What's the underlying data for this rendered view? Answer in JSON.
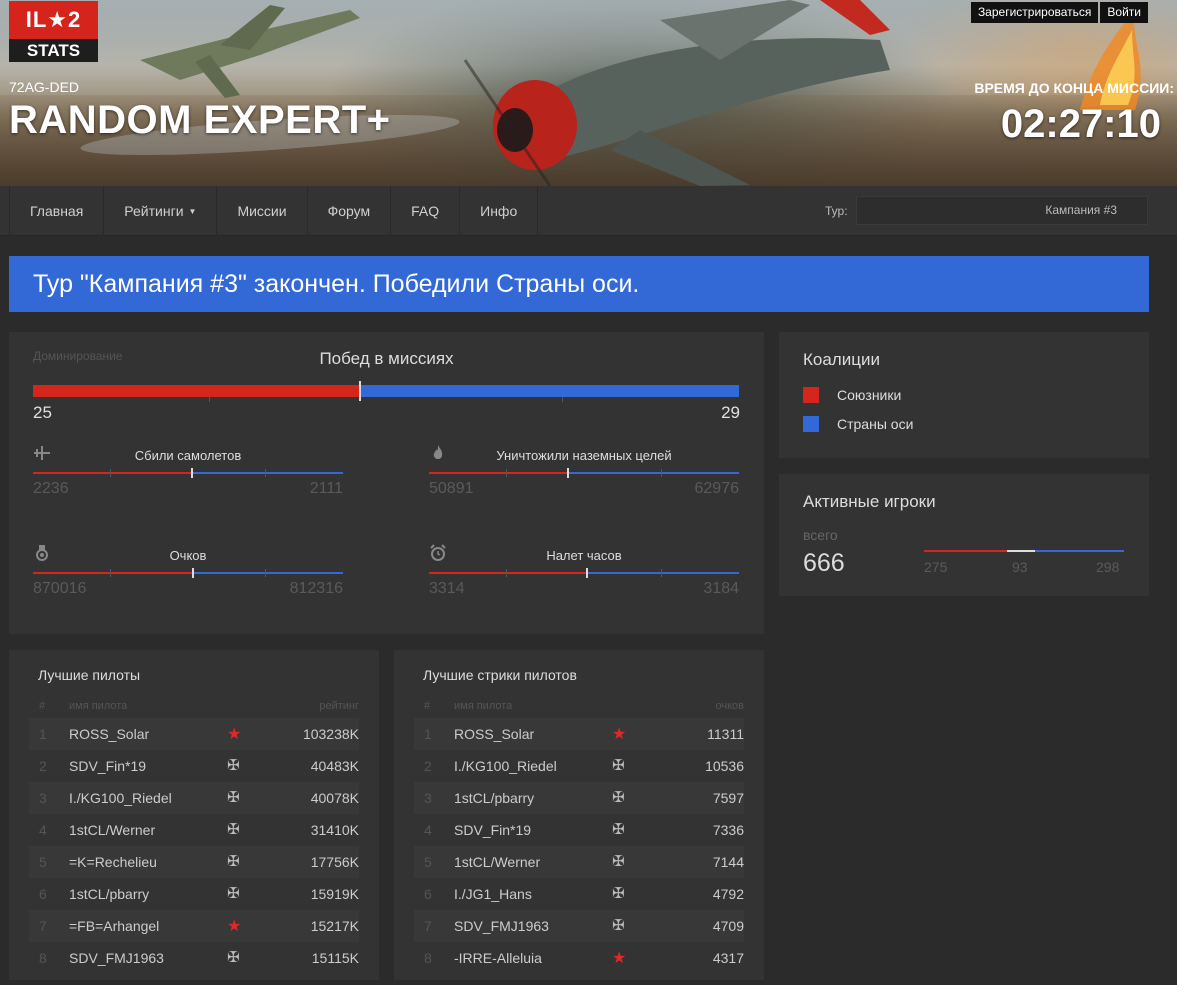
{
  "header": {
    "logo_top": "IL★2",
    "logo_bottom": "STATS",
    "server": "72AG-DED",
    "mission": "RANDOM EXPERT+",
    "register_label": "Зарегистрироваться",
    "login_label": "Войти",
    "timer_label": "ВРЕМЯ ДО КОНЦА МИССИИ:",
    "timer": "02:27:10"
  },
  "nav": {
    "items": [
      "Главная",
      "Рейтинги",
      "Миссии",
      "Форум",
      "FAQ",
      "Инфо"
    ],
    "tour_label": "Тур:",
    "tour_value": "Кампания #3"
  },
  "notice": "Тур \"Кампания #3\" закончен. Победили Страны оси.",
  "colors": {
    "allies": "#d5261b",
    "axis": "#3369d6",
    "notice": "#3369d6"
  },
  "stats": {
    "dom_label": "Доминирование",
    "wins_title": "Побед в миссиях",
    "wins_allies": "25",
    "wins_axis": "29",
    "metrics": [
      {
        "icon": "airplane-icon",
        "label": "Сбили самолетов",
        "allies": "2236",
        "axis": "2111"
      },
      {
        "icon": "fire-icon",
        "label": "Уничтожили наземных целей",
        "allies": "50891",
        "axis": "62976"
      },
      {
        "icon": "medal-icon",
        "label": "Очков",
        "allies": "870016",
        "axis": "812316"
      },
      {
        "icon": "alarm-clock-icon",
        "label": "Налет часов",
        "allies": "3314",
        "axis": "3184"
      }
    ]
  },
  "coalitions": {
    "title": "Коалиции",
    "allies_label": "Союзники",
    "axis_label": "Страны оси"
  },
  "active": {
    "title": "Активные игроки",
    "sub": "всего",
    "total": "666",
    "allies": "275",
    "neutral": "93",
    "axis": "298"
  },
  "best_pilots": {
    "title": "Лучшие пилоты",
    "col_num": "#",
    "col_name": "имя пилота",
    "col_val": "рейтинг",
    "rows": [
      {
        "num": "1",
        "name": "ROSS_Solar",
        "side": "star",
        "val": "103238K"
      },
      {
        "num": "2",
        "name": "SDV_Fin*19",
        "side": "cross",
        "val": "40483K"
      },
      {
        "num": "3",
        "name": "I./KG100_Riedel",
        "side": "cross",
        "val": "40078K"
      },
      {
        "num": "4",
        "name": "1stCL/Werner",
        "side": "cross",
        "val": "31410K"
      },
      {
        "num": "5",
        "name": "=K=Rechelieu",
        "side": "cross",
        "val": "17756K"
      },
      {
        "num": "6",
        "name": "1stCL/pbarry",
        "side": "cross",
        "val": "15919K"
      },
      {
        "num": "7",
        "name": "=FB=Arhangel",
        "side": "star",
        "val": "15217K"
      },
      {
        "num": "8",
        "name": "SDV_FMJ1963",
        "side": "cross",
        "val": "15115K"
      }
    ]
  },
  "best_streaks": {
    "title": "Лучшие стрики пилотов",
    "col_num": "#",
    "col_name": "имя пилота",
    "col_val": "очков",
    "rows": [
      {
        "num": "1",
        "name": "ROSS_Solar",
        "side": "star",
        "val": "11311"
      },
      {
        "num": "2",
        "name": "I./KG100_Riedel",
        "side": "cross",
        "val": "10536"
      },
      {
        "num": "3",
        "name": "1stCL/pbarry",
        "side": "cross",
        "val": "7597"
      },
      {
        "num": "4",
        "name": "SDV_Fin*19",
        "side": "cross",
        "val": "7336"
      },
      {
        "num": "5",
        "name": "1stCL/Werner",
        "side": "cross",
        "val": "7144"
      },
      {
        "num": "6",
        "name": "I./JG1_Hans",
        "side": "cross",
        "val": "4792"
      },
      {
        "num": "7",
        "name": "SDV_FMJ1963",
        "side": "cross",
        "val": "4709"
      },
      {
        "num": "8",
        "name": "-IRRE-Alleluia",
        "side": "star",
        "val": "4317"
      }
    ]
  }
}
